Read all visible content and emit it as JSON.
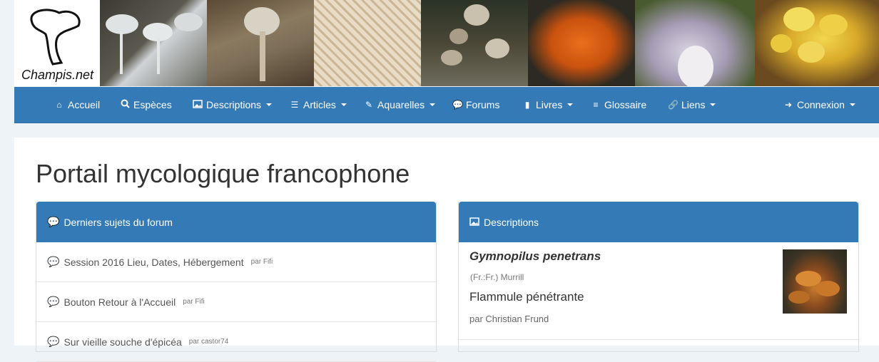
{
  "site": {
    "name": "Champis.net"
  },
  "nav": {
    "items": [
      {
        "label": "Accueil",
        "icon": "home-icon",
        "dropdown": false
      },
      {
        "label": "Espèces",
        "icon": "search-icon",
        "dropdown": false
      },
      {
        "label": "Descriptions",
        "icon": "picture-icon",
        "dropdown": true
      },
      {
        "label": "Articles",
        "icon": "align-left-icon",
        "dropdown": true
      },
      {
        "label": "Aquarelles",
        "icon": "brush-icon",
        "dropdown": true
      },
      {
        "label": "Forums",
        "icon": "comments-icon",
        "dropdown": false
      },
      {
        "label": "Livres",
        "icon": "book-icon",
        "dropdown": true
      },
      {
        "label": "Glossaire",
        "icon": "list-icon",
        "dropdown": false
      },
      {
        "label": "Liens",
        "icon": "link-icon",
        "dropdown": true
      }
    ],
    "login": {
      "label": "Connexion",
      "icon": "sign-in-icon",
      "dropdown": true
    }
  },
  "page": {
    "title": "Portail mycologique francophone"
  },
  "forum_panel": {
    "heading": "Derniers sujets du forum",
    "items": [
      {
        "title": "Session 2016 Lieu, Dates, Hébergement",
        "by": "par Fifi"
      },
      {
        "title": "Bouton Retour à l'Accueil",
        "by": "par Fifi"
      },
      {
        "title": "Sur vieille souche d'épicéa",
        "by": "par castor74"
      }
    ]
  },
  "desc_panel": {
    "heading": "Descriptions",
    "item": {
      "latin": "Gymnopilus penetrans",
      "author": "(Fr.:Fr.) Murrill",
      "common": "Flammule pénétrante",
      "by": "par Christian Frund"
    }
  },
  "colors": {
    "primary": "#337ab7",
    "background": "#eef3f8"
  }
}
